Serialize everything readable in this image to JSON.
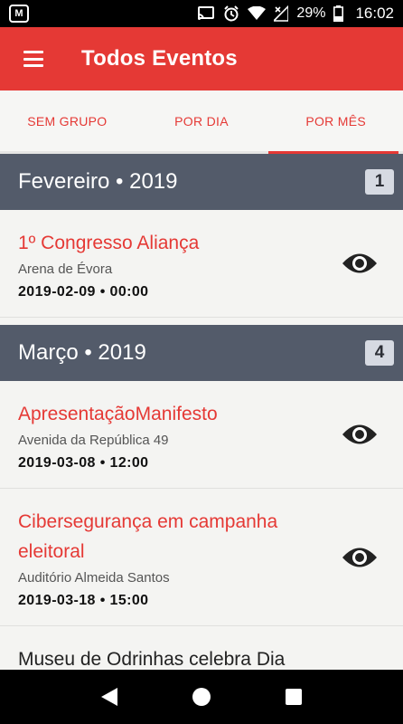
{
  "status_bar": {
    "app_badge": "M",
    "battery": "29%",
    "time": "16:02",
    "icons": [
      "cast-icon",
      "alarm-icon",
      "wifi-icon",
      "signal-icon",
      "battery-icon"
    ]
  },
  "app_bar": {
    "title": "Todos Eventos",
    "menu_icon": "hamburger-menu-icon",
    "color": "#e53935"
  },
  "tabs": [
    {
      "label": "SEM GRUPO",
      "active": false
    },
    {
      "label": "POR DIA",
      "active": false
    },
    {
      "label": "POR MÊS",
      "active": true
    }
  ],
  "groups": [
    {
      "header": "Fevereiro • 2019",
      "count": "1",
      "events": [
        {
          "title": "1º Congresso Aliança",
          "location": "Arena de Évora",
          "datetime": "2019-02-09 • 00:00"
        }
      ]
    },
    {
      "header": "Março • 2019",
      "count": "4",
      "events": [
        {
          "title": "ApresentaçãoManifesto",
          "location": "Avenida da República 49",
          "datetime": "2019-03-08 • 12:00"
        },
        {
          "title": "Cibersegurança em campanha eleitoral",
          "location": "Auditório Almeida Santos",
          "datetime": "2019-03-18 • 15:00"
        }
      ]
    }
  ],
  "partial_event": {
    "title": "Museu de Odrinhas celebra Dia"
  },
  "nav_bar": {
    "icons": [
      "back-icon",
      "home-icon",
      "recents-icon"
    ]
  },
  "colors": {
    "accent": "#e53935",
    "group_header": "#535b6a",
    "background": "#f4f4f2"
  }
}
